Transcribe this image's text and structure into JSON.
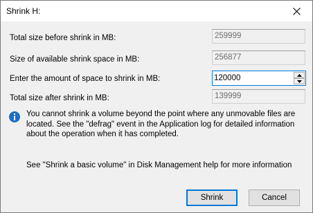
{
  "window": {
    "title": "Shrink H:"
  },
  "fields": {
    "total_before_label": "Total size before shrink in MB:",
    "total_before_value": "259999",
    "available_label": "Size of available shrink space in MB:",
    "available_value": "256877",
    "amount_label": "Enter the amount of space to shrink in MB:",
    "amount_value": "120000",
    "total_after_label": "Total size after shrink in MB:",
    "total_after_value": "139999"
  },
  "info": {
    "icon": "info-icon",
    "text": "You cannot shrink a volume beyond the point where any unmovable files are located. See the \"defrag\" event in the Application log for detailed information about the operation when it has completed."
  },
  "help": {
    "text": "See \"Shrink a basic volume\" in Disk Management help for more information"
  },
  "buttons": {
    "shrink": "Shrink",
    "cancel": "Cancel"
  },
  "colors": {
    "accent": "#0078d7",
    "info_icon": "#1a6fc9",
    "dialog_bg": "#f0f0f0"
  }
}
